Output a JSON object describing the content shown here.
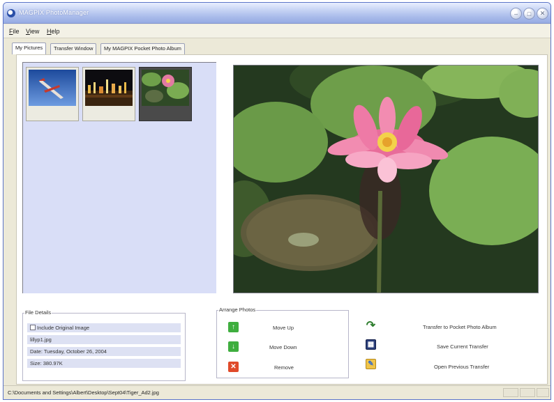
{
  "window": {
    "title": "MAGPIX PhotoManager",
    "colors": {
      "titlebar": "#a9bbea",
      "thumb_pane": "#d9def7",
      "detail_rows": "#dde1f3"
    }
  },
  "menu": [
    "File",
    "View",
    "Help"
  ],
  "tabs": [
    "My Pictures",
    "Transfer Window",
    "My MAGPIX Pocket Photo Album"
  ],
  "thumbnails": [
    {
      "subject": "airplane",
      "selected": false
    },
    {
      "subject": "city lights at night",
      "selected": false
    },
    {
      "subject": "pink water lily",
      "selected": true
    }
  ],
  "preview": {
    "subject": "pink water lily with frog on lily pad"
  },
  "file_details": {
    "title": "File Details",
    "include_original": "Include Original Image",
    "include_checked": false,
    "name": "lillyp1.jpg",
    "date": "Date: Tuesday, October 26, 2004",
    "size": "Size: 380.97K"
  },
  "arrange": {
    "title": "Arrange Photos",
    "move_up": "Move Up",
    "move_down": "Move Down",
    "remove": "Remove"
  },
  "transfer": {
    "transfer_to_album": "Transfer to Pocket Photo Album",
    "save_transfer": "Save Current Transfer",
    "open_transfer": "Open Previous Transfer"
  },
  "icons": {
    "move_up": "green-up-arrow-icon",
    "move_down": "green-down-arrow-icon",
    "remove": "red-x-icon",
    "transfer": "transfer-arrow-icon",
    "save": "save-disk-icon",
    "open": "open-folder-icon"
  },
  "status": {
    "path": "C:\\Documents and Settings\\Albert\\Desktop\\Sept04\\Tiger_Ad2.jpg"
  }
}
